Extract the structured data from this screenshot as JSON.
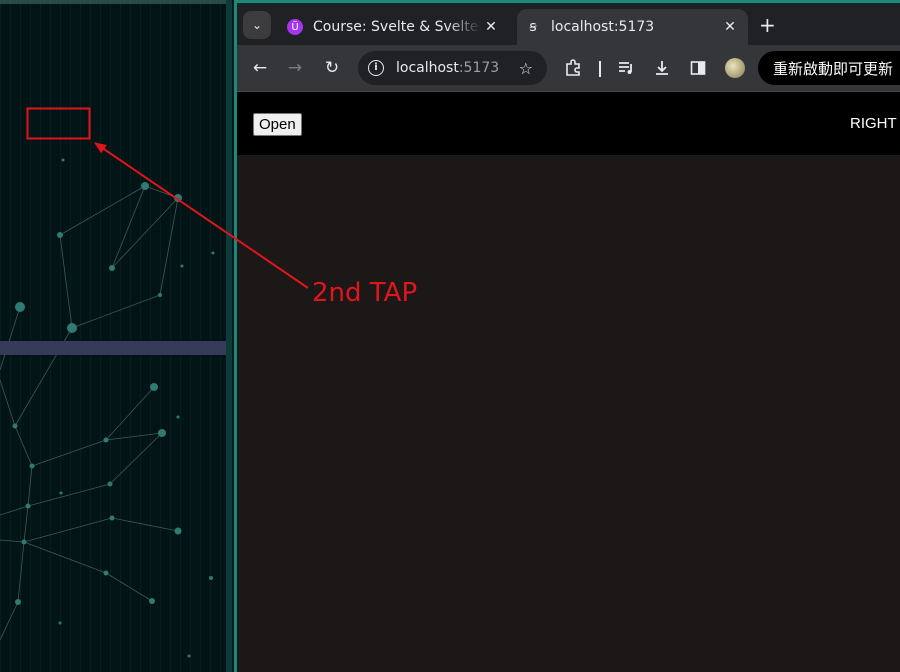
{
  "browser": {
    "tabs": [
      {
        "title": "Course: Svelte & SvelteKit",
        "favicon": "udemy-icon",
        "close": "✕",
        "active": false
      },
      {
        "title": "localhost:5173",
        "favicon": "svelte-icon",
        "close": "✕",
        "active": true
      }
    ],
    "new_tab": "+",
    "omnibox": {
      "host": "localhost",
      "port": ":5173"
    },
    "update_button": "重新啟動即可更新"
  },
  "page": {
    "open_button": "Open",
    "right_text": "RIGHT"
  },
  "annotation": {
    "label": "2nd TAP",
    "color": "#e1151c"
  },
  "colors": {
    "desktop_bg": "#031416",
    "browser_frame": "#1c8a7a",
    "page_bg": "#1b1817",
    "header_bg": "#000000"
  }
}
